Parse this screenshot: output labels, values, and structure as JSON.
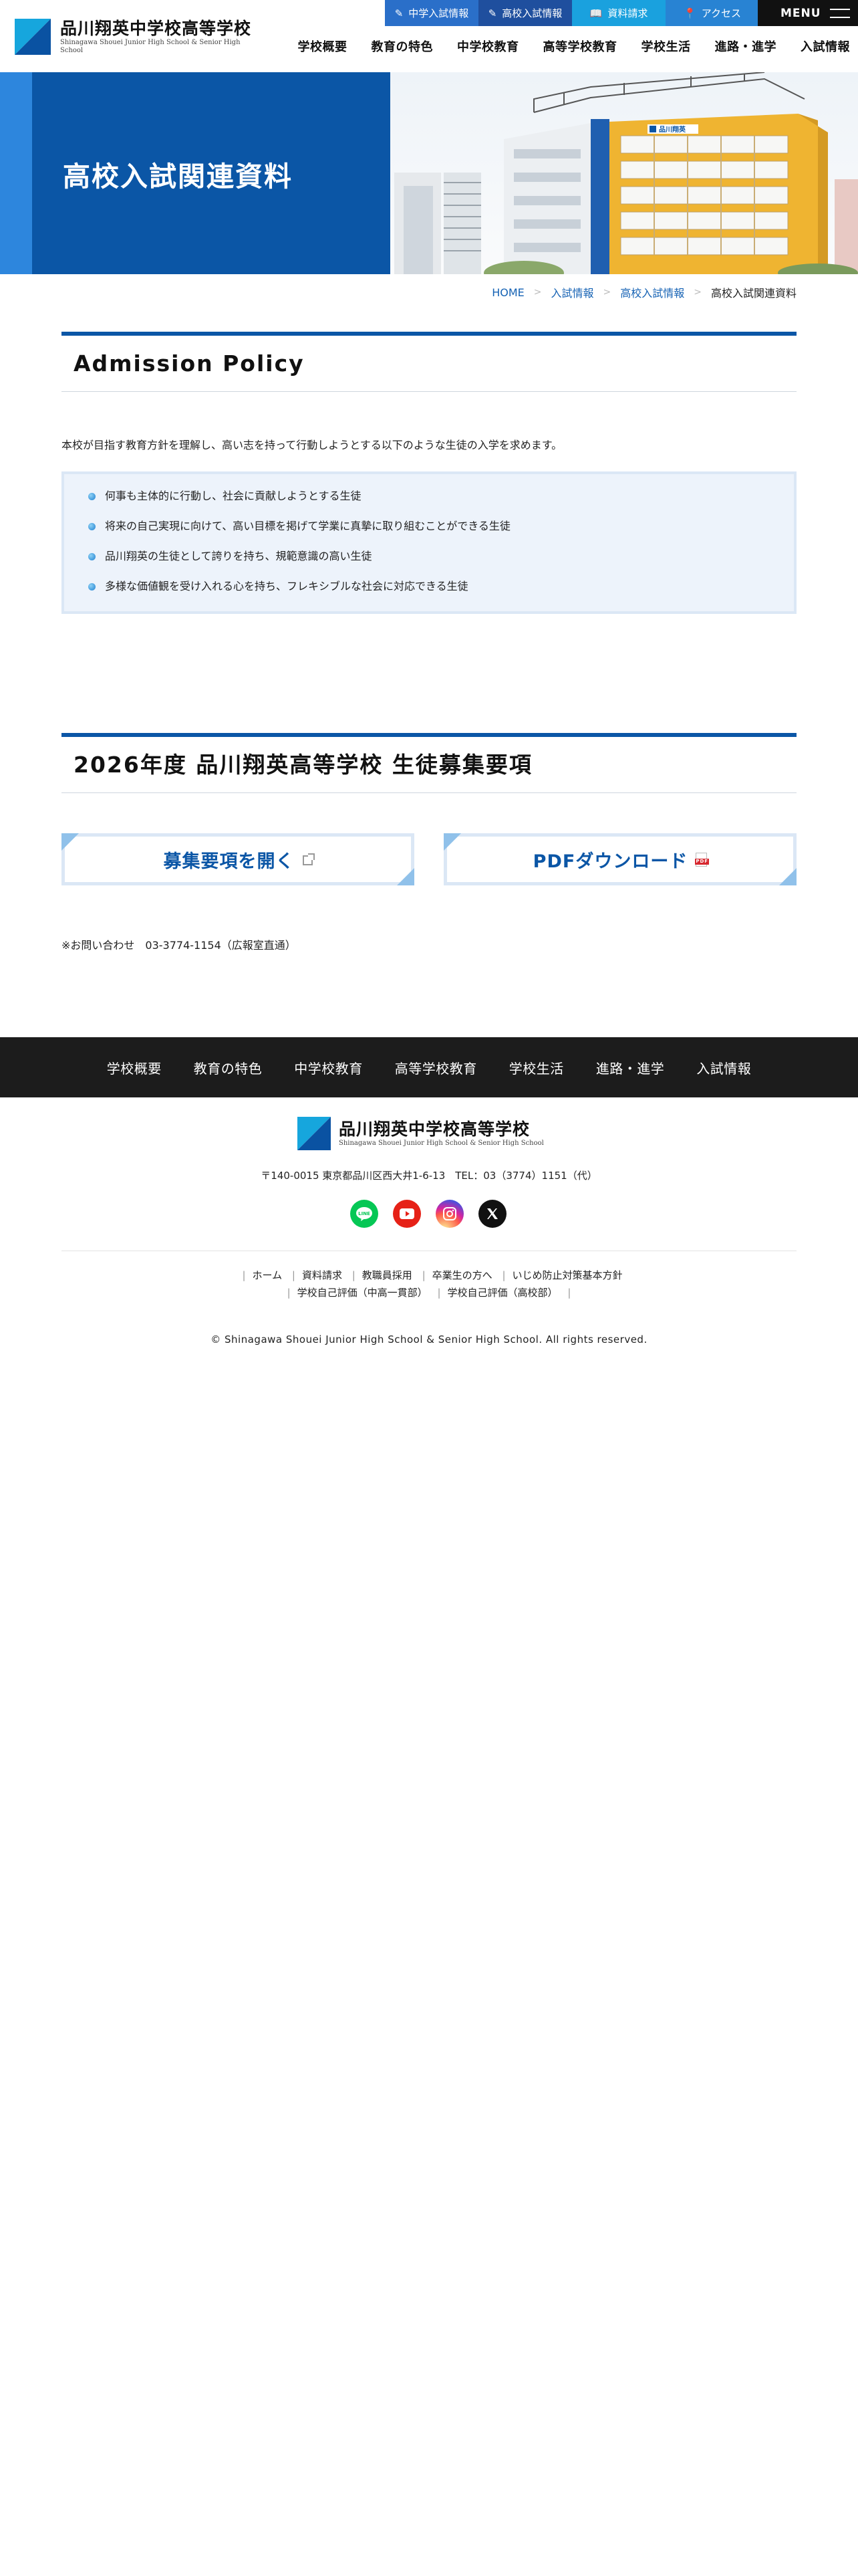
{
  "header": {
    "logo_jp": "品川翔英中学校高等学校",
    "logo_en": "Shinagawa Shouei Junior High School & Senior High School",
    "topbar": [
      {
        "label": "中学入試情報",
        "icon": "pencil-icon"
      },
      {
        "label": "高校入試情報",
        "icon": "pencil-icon"
      },
      {
        "label": "資料請求",
        "icon": "book-icon"
      },
      {
        "label": "アクセス",
        "icon": "map-pin-icon"
      }
    ],
    "menu_label": "MENU",
    "nav": [
      "学校概要",
      "教育の特色",
      "中学校教育",
      "高等学校教育",
      "学校生活",
      "進路・進学",
      "入試情報"
    ]
  },
  "hero": {
    "title": "高校入試関連資料",
    "building_sign": "品川翔英"
  },
  "breadcrumb": [
    "HOME",
    "入試情報",
    "高校入試情報",
    "高校入試関連資料"
  ],
  "policy": {
    "heading": "Admission Policy",
    "intro": "本校が目指す教育方針を理解し、高い志を持って行動しようとする以下のような生徒の入学を求めます。",
    "items": [
      "何事も主体的に行動し、社会に貢献しようとする生徒",
      "将来の自己実現に向けて、高い目標を掲げて学業に真摯に取り組むことができる生徒",
      "品川翔英の生徒として誇りを持ち、規範意識の高い生徒",
      "多様な価値観を受け入れる心を持ち、フレキシブルな社会に対応できる生徒"
    ]
  },
  "recruit": {
    "heading": "2026年度 品川翔英高等学校 生徒募集要項",
    "open_button": "募集要項を開く",
    "pdf_button": "PDFダウンロード",
    "contact": "※お問い合わせ　03-3774-1154（広報室直通）"
  },
  "footer": {
    "nav": [
      "学校概要",
      "教育の特色",
      "中学校教育",
      "高等学校教育",
      "学校生活",
      "進路・進学",
      "入試情報"
    ],
    "logo_jp": "品川翔英中学校高等学校",
    "logo_en": "Shinagawa Shouei Junior High School & Senior High School",
    "address": "〒140-0015 東京都品川区西大井1-6-13　TEL：03（3774）1151（代）",
    "sns": [
      {
        "name": "LINE",
        "icon": "line-icon"
      },
      {
        "name": "YouTube",
        "icon": "youtube-icon"
      },
      {
        "name": "Instagram",
        "icon": "instagram-icon"
      },
      {
        "name": "X",
        "icon": "x-icon"
      }
    ],
    "links_row1": [
      "ホーム",
      "資料請求",
      "教職員採用",
      "卒業生の方へ",
      "いじめ防止対策基本方針"
    ],
    "links_row2": [
      "学校自己評価（中高一貫部）",
      "学校自己評価（高校部）"
    ],
    "copyright": "© Shinagawa Shouei Junior High School & Senior High School. All rights reserved."
  },
  "colors": {
    "brand_blue": "#0b56a6",
    "accent_cyan": "#16a6dd",
    "link_blue": "#1562b4",
    "footer_nav_bg": "#1c1c1c"
  }
}
